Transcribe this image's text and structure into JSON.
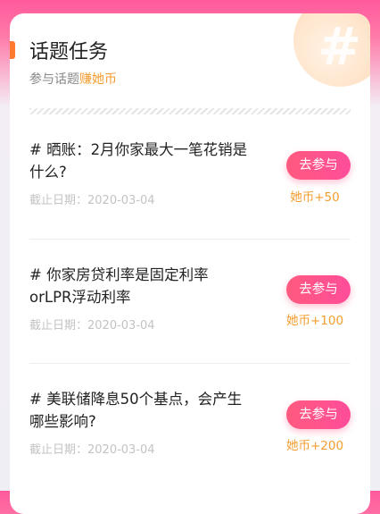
{
  "header": {
    "title": "话题任务",
    "subtitle_prefix": "参与话题",
    "subtitle_accent": "赚她币"
  },
  "tasks": [
    {
      "title": "# 晒账：2月你家最大一笔花销是什么?",
      "date": "截止日期：2020-03-04",
      "button": "去参与",
      "reward": "她币+50"
    },
    {
      "title": "# 你家房贷利率是固定利率orLPR浮动利率",
      "date": "截止日期：2020-03-04",
      "button": "去参与",
      "reward": "她币+100"
    },
    {
      "title": "# 美联储降息50个基点，会产生哪些影响?",
      "date": "截止日期：2020-03-04",
      "button": "去参与",
      "reward": "她币+200"
    }
  ],
  "colors": {
    "accent_orange": "#f39c2f",
    "button_pink": "#ff4d8f",
    "title_bar": "#ff7a2f"
  },
  "icons": {
    "corner": "hash-icon"
  }
}
